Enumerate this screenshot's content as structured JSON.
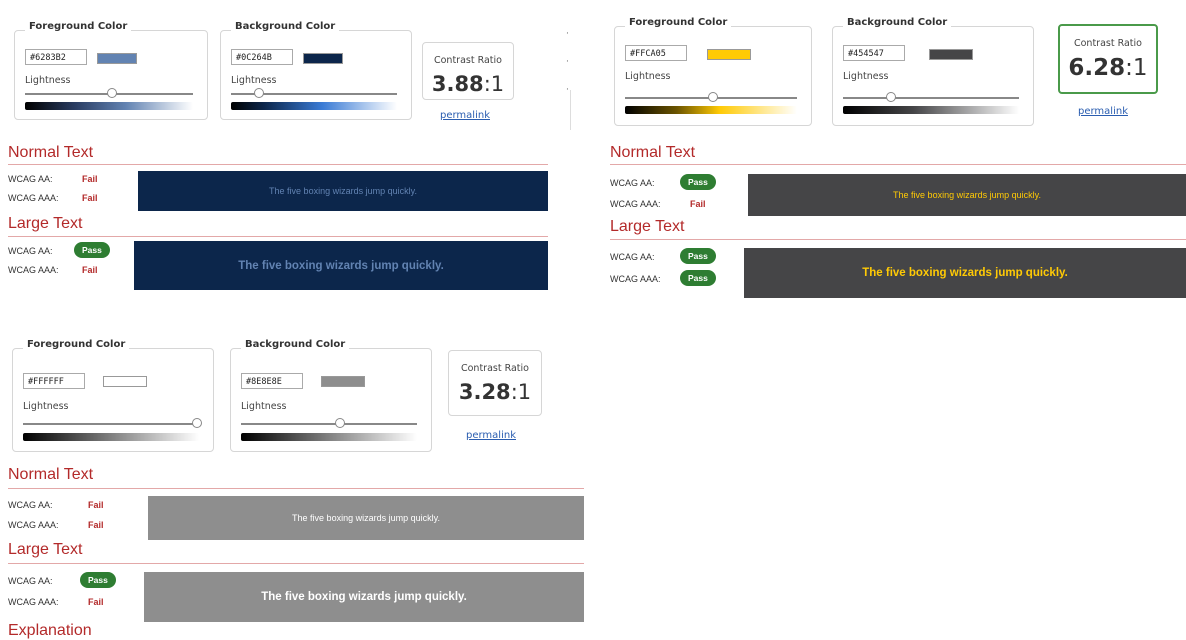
{
  "common": {
    "fg_label": "Foreground Color",
    "bg_label": "Background Color",
    "lightness_label": "Lightness",
    "ratio_label": "Contrast Ratio",
    "permalink": "permalink",
    "normal_text": "Normal Text",
    "large_text": "Large Text",
    "wcag_aa": "WCAG AA:",
    "wcag_aaa": "WCAG AAA:",
    "sample_text": "The five boxing wizards jump quickly."
  },
  "panels": [
    {
      "fg_hex": "#6283B2",
      "fg_color": "#6283b2",
      "fg_lightness": 0.55,
      "bg_hex": "#0C264B",
      "bg_color": "#0c264b",
      "bg_lightness": 0.17,
      "ratio": "3.88",
      "ratio_suffix": ":1",
      "normal_aa": "Fail",
      "normal_aaa": "Fail",
      "large_aa": "Pass",
      "large_aaa": "Fail"
    },
    {
      "fg_hex": "#FFCA05",
      "fg_color": "#ffca05",
      "fg_lightness": 0.51,
      "bg_hex": "#454547",
      "bg_color": "#454547",
      "bg_lightness": 0.27,
      "ratio": "6.28",
      "ratio_suffix": ":1",
      "normal_aa": "Pass",
      "normal_aaa": "Fail",
      "large_aa": "Pass",
      "large_aaa": "Pass"
    },
    {
      "fg_hex": "#FFFFFF",
      "fg_color": "#ffffff",
      "fg_lightness": 1.0,
      "bg_hex": "#8E8E8E",
      "bg_color": "#8e8e8e",
      "bg_lightness": 0.56,
      "ratio": "3.28",
      "ratio_suffix": ":1",
      "normal_aa": "Fail",
      "normal_aaa": "Fail",
      "large_aa": "Pass",
      "large_aaa": "Fail",
      "cutoff_heading": "Explanation"
    }
  ]
}
